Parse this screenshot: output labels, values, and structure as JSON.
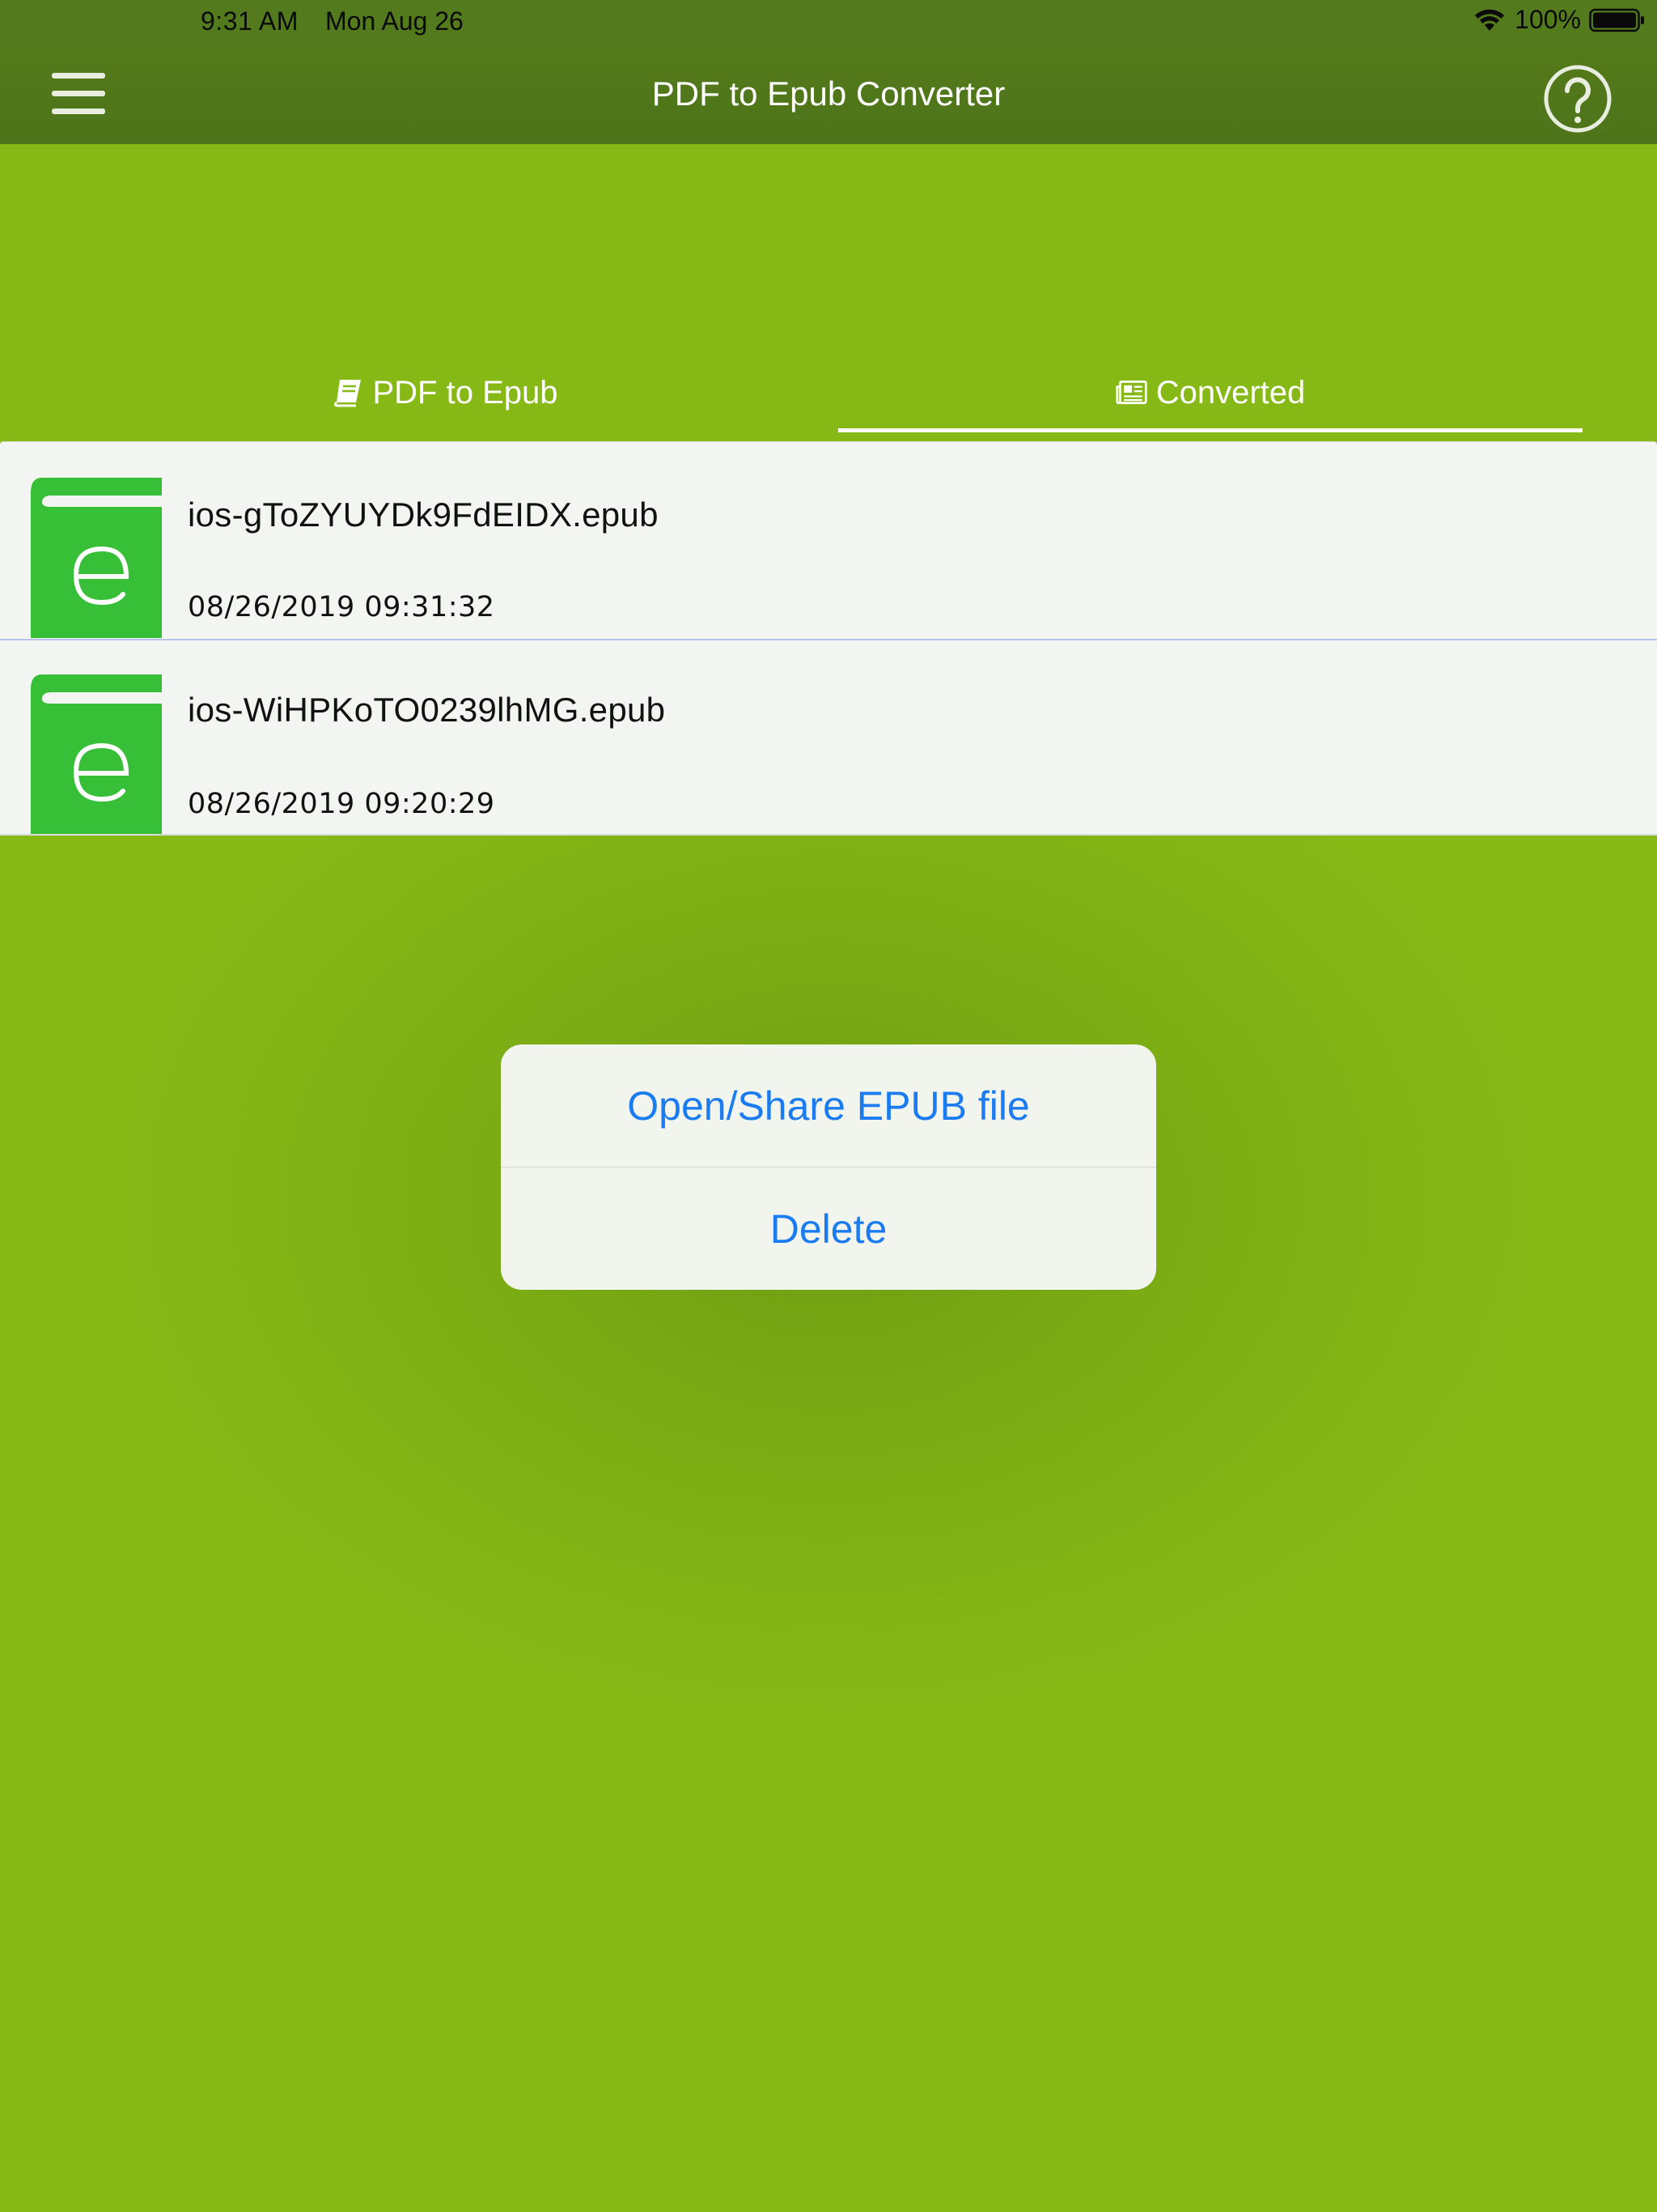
{
  "status_bar": {
    "time": "9:31 AM",
    "date": "Mon Aug 26",
    "battery": "100%"
  },
  "nav": {
    "title": "PDF to Epub Converter"
  },
  "tabs": [
    {
      "label": "PDF to Epub",
      "icon": "book-icon",
      "selected": false
    },
    {
      "label": "Converted",
      "icon": "newspaper-icon",
      "selected": true
    }
  ],
  "files": [
    {
      "name": "ios-gToZYUYDk9FdEIDX.epub",
      "date": "08/26/2019 09:31:32"
    },
    {
      "name": "ios-WiHPKoTO0239lhMG.epub",
      "date": "08/26/2019 09:20:29"
    }
  ],
  "action_sheet": {
    "open_label": "Open/Share EPUB file",
    "delete_label": "Delete"
  },
  "colors": {
    "background": "#86b916",
    "nav_bar": "#4f761a",
    "list_bg": "#f3f5f2",
    "epub_icon": "#37bf38",
    "action_text": "#1a7cf0"
  }
}
